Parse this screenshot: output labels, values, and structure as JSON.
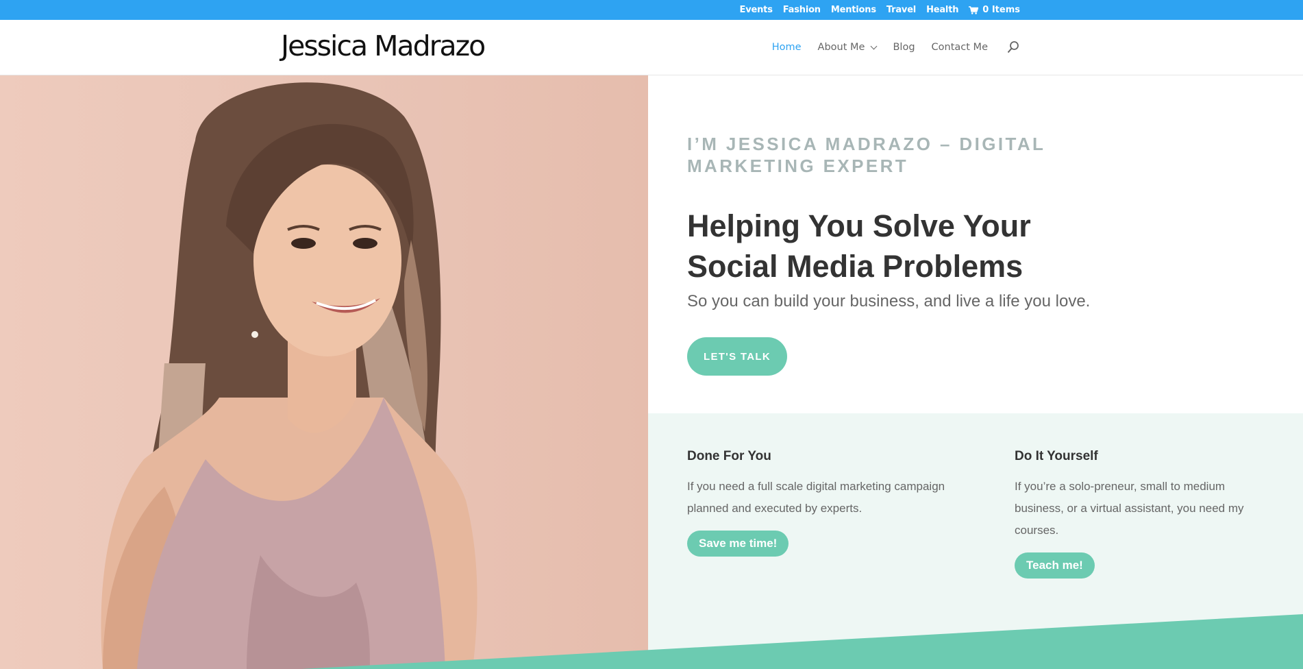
{
  "topbar": {
    "links": [
      "Events",
      "Fashion",
      "Mentions",
      "Travel",
      "Health"
    ],
    "cart_label": "0 Items"
  },
  "header": {
    "logo": "Jessica Madrazo",
    "nav": {
      "home": "Home",
      "about": "About Me",
      "blog": "Blog",
      "contact": "Contact Me"
    }
  },
  "hero": {
    "eyebrow": "I’M JESSICA MADRAZO – DIGITAL MARKETING EXPERT",
    "headline": "Helping You Solve Your Social Media Problems",
    "subheadline": "So you can build your business, and live a life you love.",
    "cta_label": "LET'S TALK"
  },
  "services": [
    {
      "title": "Done For You",
      "description": "If you need a full scale digital marketing campaign planned and executed by experts.",
      "button": "Save me time!"
    },
    {
      "title": "Do It Yourself",
      "description": "If you’re a solo-preneur, small to medium business, or a virtual assistant, you need my courses.",
      "button": "Teach me!"
    }
  ],
  "colors": {
    "topbar": "#2ea3f2",
    "accent": "#6ccbb1",
    "nav_active": "#2ea3f2",
    "services_bg": "#eef7f4"
  },
  "icons": {
    "cart": "cart-icon",
    "search": "search-icon",
    "dropdown": "chevron-down-icon"
  }
}
